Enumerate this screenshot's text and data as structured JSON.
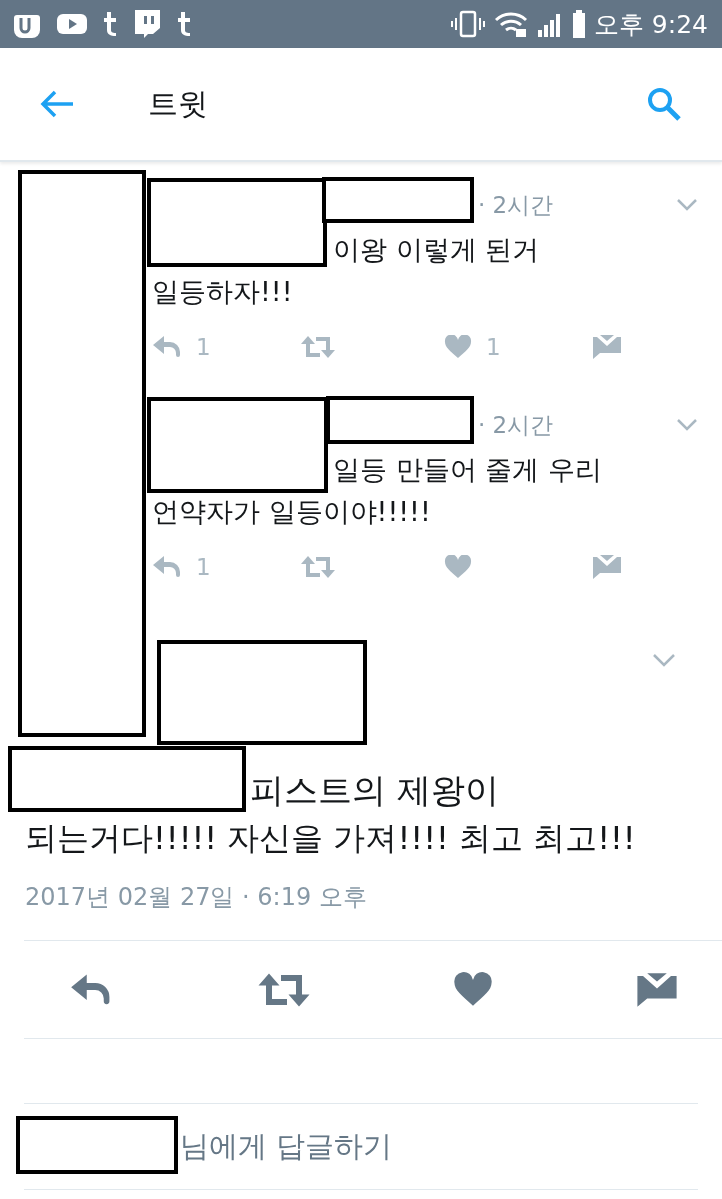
{
  "status_bar": {
    "time": "오후 9:24"
  },
  "header": {
    "title": "트윗"
  },
  "replies": [
    {
      "time": "· 2시간",
      "line_1": "이왕 이렇게 된거",
      "line_2": "일등하자!!!",
      "reply_count": "1",
      "like_count": "1"
    },
    {
      "time": "· 2시간",
      "line_1": "일등 만들어 줄게 우리",
      "line_2": "언약자가 일등이야!!!!!",
      "reply_count": "1"
    }
  ],
  "tweet": {
    "line_1": "피스트의 제왕이",
    "line_2": "되는거다!!!!! 자신을 가져!!!! 최고 최고!!!",
    "timestamp": "2017년 02월 27일 · 6:19 오후"
  },
  "reply_prompt": "님에게 답글하기"
}
